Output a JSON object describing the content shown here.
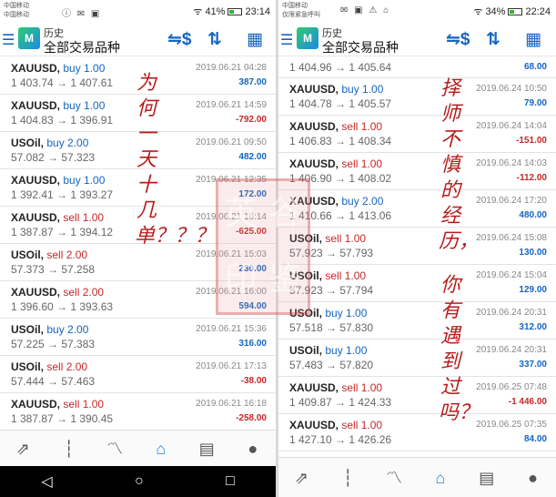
{
  "left": {
    "status": {
      "carrier1": "中国移动",
      "carrier2": "中国移动",
      "icons": "ⓘ ✉ ▣",
      "right": "ᯤ 41%",
      "time": "23:14"
    },
    "appbar": {
      "history": "历史",
      "symbol_title": "全部交易品种"
    },
    "rows": [
      {
        "symbol": "XAUUSD,",
        "side": "buy 1.00",
        "type": "buy",
        "prices": "1 403.74 → 1 407.61",
        "date": "2019.06.21 04:28",
        "profit": "387.00",
        "profit_sign": "pos"
      },
      {
        "symbol": "XAUUSD,",
        "side": "buy 1.00",
        "type": "buy",
        "prices": "1 404.83 → 1 396.91",
        "date": "2019.06.21 14:59",
        "profit": "-792.00",
        "profit_sign": "neg"
      },
      {
        "symbol": "USOil,",
        "side": "buy 2.00",
        "type": "buy",
        "prices": "57.082 → 57.323",
        "date": "2019.06.21 09:50",
        "profit": "482.00",
        "profit_sign": "pos"
      },
      {
        "symbol": "XAUUSD,",
        "side": "buy 1.00",
        "type": "buy",
        "prices": "1 392.41 → 1 393.27",
        "date": "2019.06.21 12:35",
        "profit": "172.00",
        "profit_sign": "pos"
      },
      {
        "symbol": "XAUUSD,",
        "side": "sell 1.00",
        "type": "sell",
        "prices": "1 387.87 → 1 394.12",
        "date": "2019.06.21 16:14",
        "profit": "-625.00",
        "profit_sign": "neg"
      },
      {
        "symbol": "USOil,",
        "side": "sell 2.00",
        "type": "sell",
        "prices": "57.373 → 57.258",
        "date": "2019.06.21 15:03",
        "profit": "230.00",
        "profit_sign": "pos"
      },
      {
        "symbol": "XAUUSD,",
        "side": "sell 2.00",
        "type": "sell",
        "prices": "1 396.60 → 1 393.63",
        "date": "2019.06.21 16:00",
        "profit": "594.00",
        "profit_sign": "pos"
      },
      {
        "symbol": "USOil,",
        "side": "buy 2.00",
        "type": "buy",
        "prices": "57.225 → 57.383",
        "date": "2019.06.21 15:36",
        "profit": "316.00",
        "profit_sign": "pos"
      },
      {
        "symbol": "USOil,",
        "side": "sell 2.00",
        "type": "sell",
        "prices": "57.444 → 57.463",
        "date": "2019.06.21 17:13",
        "profit": "-38.00",
        "profit_sign": "neg"
      },
      {
        "symbol": "XAUUSD,",
        "side": "sell 1.00",
        "type": "sell",
        "prices": "1 387.87 → 1 390.45",
        "date": "2019.06.21 16:18",
        "profit": "-258.00",
        "profit_sign": "neg"
      }
    ],
    "handwriting": "为何一天十几单？？？"
  },
  "right": {
    "status": {
      "carrier1": "中国移动",
      "carrier2": "仅限紧急呼叫",
      "icons": "✉ ▣ ⚠ ⌂",
      "right": "ᯤ 34%",
      "time": "22:24"
    },
    "appbar": {
      "history": "历史",
      "symbol_title": "全部交易品种"
    },
    "partial_row": {
      "prices": "1 404.96 → 1 405.64",
      "profit": "68.00",
      "profit_sign": "pos"
    },
    "rows": [
      {
        "symbol": "XAUUSD,",
        "side": "buy 1.00",
        "type": "buy",
        "prices": "1 404.78 → 1 405.57",
        "date": "2019.06.24 10:50",
        "profit": "79.00",
        "profit_sign": "pos"
      },
      {
        "symbol": "XAUUSD,",
        "side": "sell 1.00",
        "type": "sell",
        "prices": "1 406.83 → 1 408.34",
        "date": "2019.06.24 14:04",
        "profit": "-151.00",
        "profit_sign": "neg"
      },
      {
        "symbol": "XAUUSD,",
        "side": "sell 1.00",
        "type": "sell",
        "prices": "1 406.90 → 1 408.02",
        "date": "2019.06.24 14:03",
        "profit": "-112.00",
        "profit_sign": "neg"
      },
      {
        "symbol": "XAUUSD,",
        "side": "buy 2.00",
        "type": "buy",
        "prices": "1 410.66 → 1 413.06",
        "date": "2019.06.24 17:20",
        "profit": "480.00",
        "profit_sign": "pos"
      },
      {
        "symbol": "USOil,",
        "side": "sell 1.00",
        "type": "sell",
        "prices": "57.923 → 57.793",
        "date": "2019.06.24 15:08",
        "profit": "130.00",
        "profit_sign": "pos"
      },
      {
        "symbol": "USOil,",
        "side": "sell 1.00",
        "type": "sell",
        "prices": "57.923 → 57.794",
        "date": "2019.06.24 15:04",
        "profit": "129.00",
        "profit_sign": "pos"
      },
      {
        "symbol": "USOil,",
        "side": "buy 1.00",
        "type": "buy",
        "prices": "57.518 → 57.830",
        "date": "2019.06.24 20:31",
        "profit": "312.00",
        "profit_sign": "pos"
      },
      {
        "symbol": "USOil,",
        "side": "buy 1.00",
        "type": "buy",
        "prices": "57.483 → 57.820",
        "date": "2019.06.24 20:31",
        "profit": "337.00",
        "profit_sign": "pos"
      },
      {
        "symbol": "XAUUSD,",
        "side": "sell 1.00",
        "type": "sell",
        "prices": "1 409.87 → 1 424.33",
        "date": "2019.06.25 07:48",
        "profit": "-1 446.00",
        "profit_sign": "neg"
      },
      {
        "symbol": "XAUUSD,",
        "side": "sell 1.00",
        "type": "sell",
        "prices": "1 427.10 → 1 426.26",
        "date": "2019.06.25 07:35",
        "profit": "84.00",
        "profit_sign": "pos"
      }
    ],
    "handwriting_1": "择师不慎的经历，",
    "handwriting_2": "你有遇到过吗？"
  },
  "tabs": [
    {
      "name": "quotes-icon",
      "glyph": "⇗"
    },
    {
      "name": "chart-icon",
      "glyph": "┆"
    },
    {
      "name": "trade-icon",
      "glyph": "〽"
    },
    {
      "name": "history-icon",
      "glyph": "⌂"
    },
    {
      "name": "news-icon",
      "glyph": "▤"
    },
    {
      "name": "chat-icon",
      "glyph": "●"
    }
  ],
  "stamp_text": [
    "英",
    "谷",
    "印",
    "鉴"
  ]
}
